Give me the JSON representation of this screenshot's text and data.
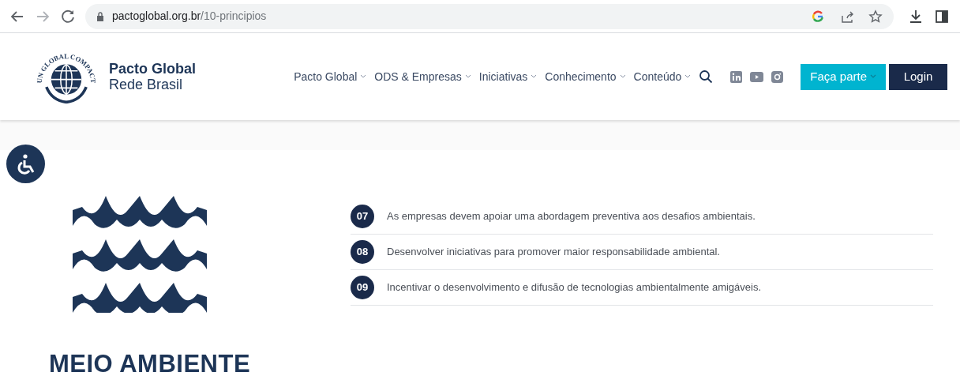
{
  "browser": {
    "url_host": "pactoglobal.org.br",
    "url_path": "/10-principios"
  },
  "header": {
    "logo_arc_text": "UN GLOBAL COMPACT",
    "brand_title": "Pacto Global",
    "brand_subtitle": "Rede Brasil",
    "nav": [
      {
        "label": "Pacto Global"
      },
      {
        "label": "ODS & Empresas"
      },
      {
        "label": "Iniciativas"
      },
      {
        "label": "Conhecimento"
      },
      {
        "label": "Conteúdo"
      }
    ],
    "social": [
      {
        "kind": "linkedin"
      },
      {
        "kind": "youtube"
      },
      {
        "kind": "instagram"
      }
    ],
    "join_button": "Faça parte",
    "login_button": "Login"
  },
  "section": {
    "title": "MEIO AMBIENTE",
    "principles": [
      {
        "number": "07",
        "text": "As empresas devem apoiar uma abordagem preventiva aos desafios ambientais."
      },
      {
        "number": "08",
        "text": "Desenvolver iniciativas para promover maior responsabilidade ambiental."
      },
      {
        "number": "09",
        "text": "Incentivar o desenvolvimento e difusão de tecnologias ambientalmente amigáveis."
      }
    ]
  }
}
